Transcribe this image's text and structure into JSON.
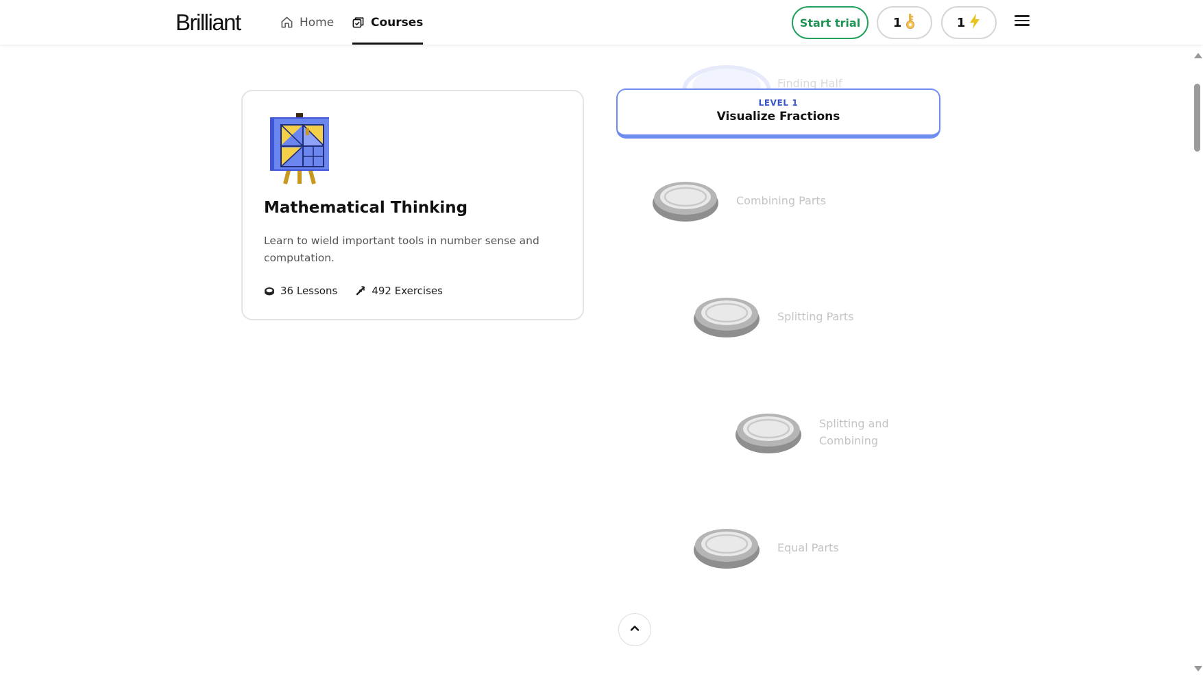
{
  "header": {
    "logo": "Brilliant",
    "nav": [
      {
        "label": "Home",
        "icon": "home-icon",
        "active": false
      },
      {
        "label": "Courses",
        "icon": "courses-icon",
        "active": true
      }
    ],
    "start_trial_label": "Start trial",
    "keys_count": "1",
    "energy_count": "1",
    "colors": {
      "trial_green": "#1f9353",
      "key_gold": "#e6b54a",
      "energy_yellow": "#e9c21c"
    }
  },
  "course": {
    "title": "Mathematical Thinking",
    "description": "Learn to wield important tools in number sense and computation.",
    "lessons": "36 Lessons",
    "exercises": "492 Exercises"
  },
  "path": {
    "ghost_lesson": "Finding Half",
    "level": {
      "tag": "LEVEL 1",
      "name": "Visualize Fractions",
      "accent": "#6f8cf0"
    },
    "lessons": [
      {
        "label": "Combining Parts"
      },
      {
        "label": "Splitting Parts"
      },
      {
        "label": "Splitting and\nCombining"
      },
      {
        "label": "Equal Parts"
      }
    ]
  }
}
